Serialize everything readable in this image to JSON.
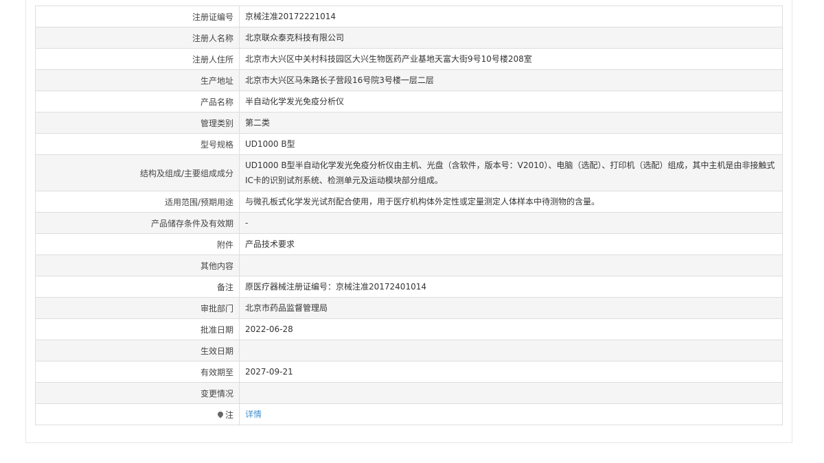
{
  "rows": [
    {
      "label": "注册证编号",
      "value": "京械注准20172221014"
    },
    {
      "label": "注册人名称",
      "value": "北京联众泰克科技有限公司"
    },
    {
      "label": "注册人住所",
      "value": "北京市大兴区中关村科技园区大兴生物医药产业基地天富大街9号10号楼208室"
    },
    {
      "label": "生产地址",
      "value": "北京市大兴区马朱路长子营段16号院3号楼一层二层"
    },
    {
      "label": "产品名称",
      "value": "半自动化学发光免疫分析仪"
    },
    {
      "label": "管理类别",
      "value": "第二类"
    },
    {
      "label": "型号规格",
      "value": "UD1000 B型"
    },
    {
      "label": "结构及组成/主要组成成分",
      "value": "UD1000 B型半自动化学发光免疫分析仪由主机、光盘（含软件，版本号：V2010）、电脑（选配）、打印机（选配）组成，其中主机是由非接触式IC卡的识别试剂系统、检测单元及运动模块部分组成。"
    },
    {
      "label": "适用范围/预期用途",
      "value": "与微孔板式化学发光试剂配合使用，用于医疗机构体外定性或定量测定人体样本中待测物的含量。"
    },
    {
      "label": "产品储存条件及有效期",
      "value": "-"
    },
    {
      "label": "附件",
      "value": "产品技术要求"
    },
    {
      "label": "其他内容",
      "value": ""
    },
    {
      "label": "备注",
      "value": "原医疗器械注册证编号：京械注准20172401014"
    },
    {
      "label": "审批部门",
      "value": "北京市药品监督管理局"
    },
    {
      "label": "批准日期",
      "value": "2022-06-28"
    },
    {
      "label": "生效日期",
      "value": ""
    },
    {
      "label": "有效期至",
      "value": "2027-09-21"
    },
    {
      "label": "变更情况",
      "value": ""
    }
  ],
  "note": {
    "label": "注",
    "link": "详情",
    "icon": "map-pin-icon"
  }
}
